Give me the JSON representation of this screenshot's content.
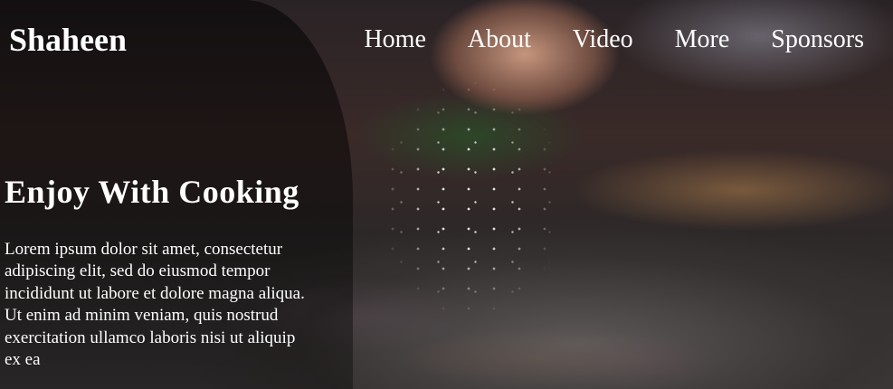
{
  "brand": {
    "name": "Shaheen"
  },
  "nav": {
    "items": [
      {
        "label": "Home"
      },
      {
        "label": "About"
      },
      {
        "label": "Video"
      },
      {
        "label": "More"
      },
      {
        "label": "Sponsors"
      }
    ]
  },
  "hero": {
    "title": "Enjoy With Cooking",
    "text": "Lorem ipsum dolor sit amet, consectetur adipiscing elit, sed do eiusmod tempor incididunt ut labore et dolore magna aliqua. Ut enim ad minim veniam, quis nostrud exercitation ullamco laboris nisi ut aliquip ex ea",
    "background_image": "hand-sprinkling-salt-over-pan"
  }
}
